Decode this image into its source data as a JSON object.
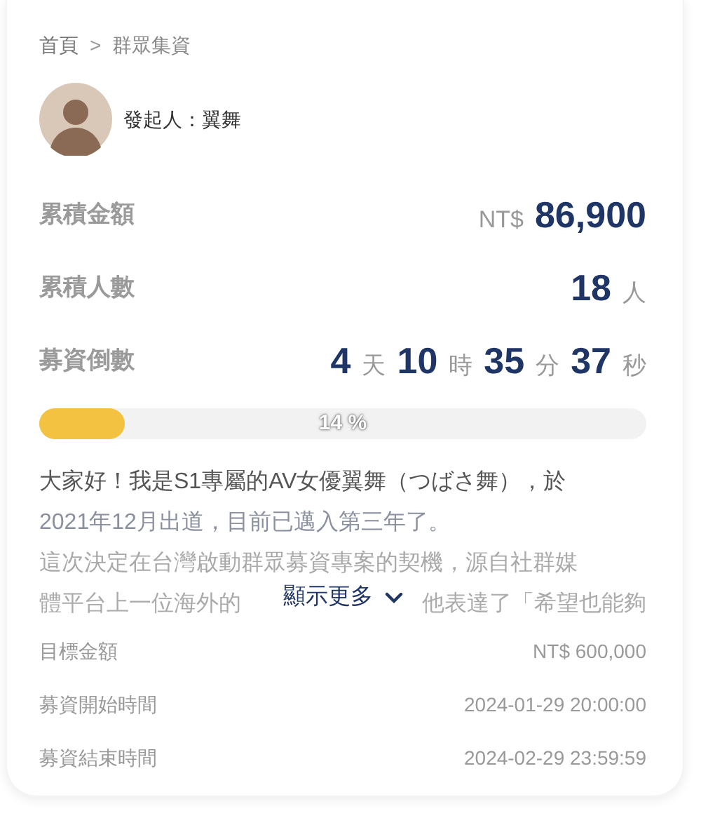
{
  "breadcrumb": [
    {
      "label": "首頁",
      "kind": "link"
    },
    {
      "label": ">",
      "kind": "separator"
    },
    {
      "label": "群眾集資",
      "kind": "current"
    }
  ],
  "initiator": {
    "label": "發起人：翼舞"
  },
  "stats": [
    {
      "label": "累積金額",
      "parts": [
        {
          "kind": "unit",
          "text": "NT$"
        },
        {
          "kind": "number",
          "text": "86,900"
        }
      ]
    },
    {
      "label": "累積人數",
      "parts": [
        {
          "kind": "number",
          "text": "18"
        },
        {
          "kind": "unit",
          "text": "人"
        }
      ]
    },
    {
      "label": "募資倒數",
      "parts": [
        {
          "kind": "number",
          "text": "4"
        },
        {
          "kind": "unit",
          "text": "天"
        },
        {
          "kind": "number",
          "text": "10"
        },
        {
          "kind": "unit",
          "text": "時"
        },
        {
          "kind": "number",
          "text": "35"
        },
        {
          "kind": "unit",
          "text": "分"
        },
        {
          "kind": "number",
          "text": "37"
        },
        {
          "kind": "unit",
          "text": "秒"
        }
      ]
    }
  ],
  "progress": {
    "level": 0.14,
    "label": "14 %"
  },
  "description": {
    "lines": [
      "大家好！我是S1專屬的AV女優翼舞（つばさ舞），於",
      "2021年12月出道，目前已邁入第三年了。",
      "這次決定在台灣啟動群眾募資專案的契機，源自社群媒"
    ],
    "last_line_left": "體平台上一位海外的",
    "last_line_right": "他表達了「希望也能夠"
  },
  "show_more": {
    "label": "顯示更多",
    "expanded": false
  },
  "details": [
    {
      "label": "目標金額",
      "value": "NT$ 600,000"
    },
    {
      "label": "募資開始時間",
      "value": "2024-01-29 20:00:00"
    },
    {
      "label": "募資結束時間",
      "value": "2024-02-29 23:59:59"
    }
  ]
}
